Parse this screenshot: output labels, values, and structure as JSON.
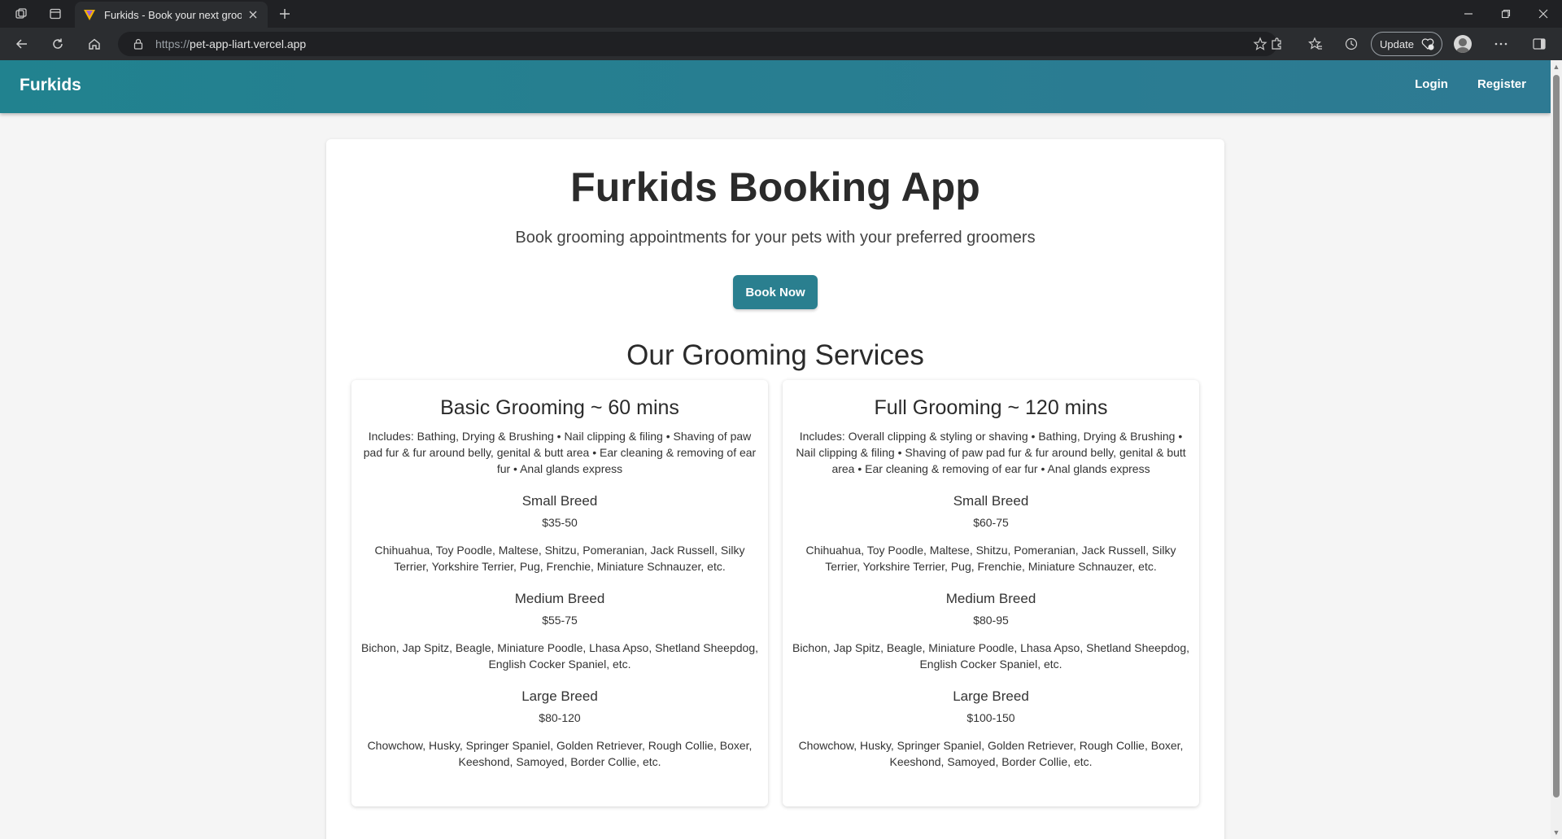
{
  "browser": {
    "tab_title": "Furkids - Book your next grooming",
    "url_scheme": "https://",
    "url_host": "pet-app-liart.vercel.app",
    "update_label": "Update"
  },
  "appbar": {
    "brand": "Furkids",
    "login": "Login",
    "register": "Register"
  },
  "hero": {
    "title": "Furkids Booking App",
    "subtitle": "Book grooming appointments for your pets with your preferred groomers",
    "cta": "Book Now"
  },
  "services": {
    "title": "Our Grooming Services",
    "cards": [
      {
        "title": "Basic Grooming ~ 60 mins",
        "includes": "Includes: Bathing, Drying & Brushing • Nail clipping & filing • Shaving of paw pad fur & fur around belly, genital & butt area • Ear cleaning & removing of ear fur • Anal glands express",
        "tiers": [
          {
            "breed": "Small Breed",
            "price": "$35-50",
            "examples": "Chihuahua, Toy Poodle, Maltese, Shitzu, Pomeranian, Jack Russell, Silky Terrier, Yorkshire Terrier, Pug, Frenchie, Miniature Schnauzer, etc."
          },
          {
            "breed": "Medium Breed",
            "price": "$55-75",
            "examples": "Bichon, Jap Spitz, Beagle, Miniature Poodle, Lhasa Apso, Shetland Sheepdog, English Cocker Spaniel, etc."
          },
          {
            "breed": "Large Breed",
            "price": "$80-120",
            "examples": "Chowchow, Husky, Springer Spaniel, Golden Retriever, Rough Collie, Boxer, Keeshond, Samoyed, Border Collie, etc."
          }
        ]
      },
      {
        "title": "Full Grooming ~ 120 mins",
        "includes": "Includes: Overall clipping & styling or shaving • Bathing, Drying & Brushing • Nail clipping & filing • Shaving of paw pad fur & fur around belly, genital & butt area • Ear cleaning & removing of ear fur • Anal glands express",
        "tiers": [
          {
            "breed": "Small Breed",
            "price": "$60-75",
            "examples": "Chihuahua, Toy Poodle, Maltese, Shitzu, Pomeranian, Jack Russell, Silky Terrier, Yorkshire Terrier, Pug, Frenchie, Miniature Schnauzer, etc."
          },
          {
            "breed": "Medium Breed",
            "price": "$80-95",
            "examples": "Bichon, Jap Spitz, Beagle, Miniature Poodle, Lhasa Apso, Shetland Sheepdog, English Cocker Spaniel, etc."
          },
          {
            "breed": "Large Breed",
            "price": "$100-150",
            "examples": "Chowchow, Husky, Springer Spaniel, Golden Retriever, Rough Collie, Boxer, Keeshond, Samoyed, Border Collie, etc."
          }
        ]
      }
    ]
  }
}
